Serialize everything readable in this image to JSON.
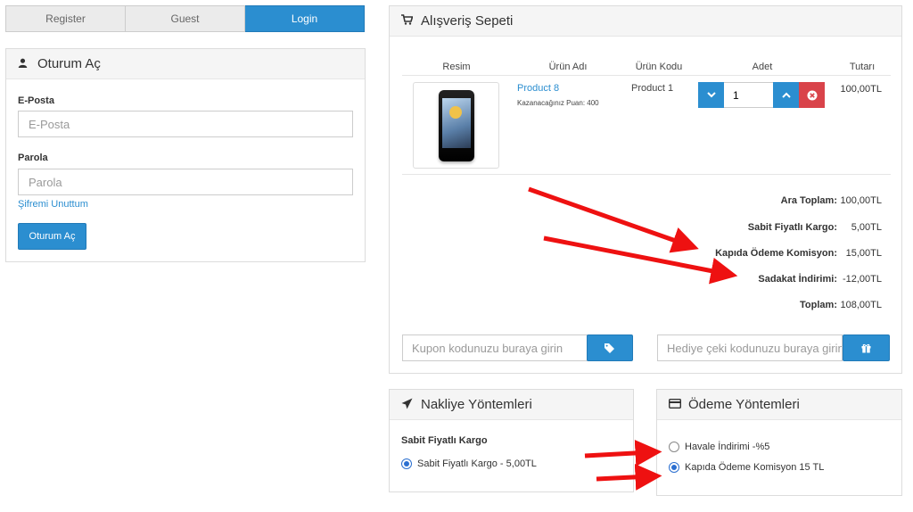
{
  "tabs": [
    {
      "label": "Register",
      "active": false
    },
    {
      "label": "Guest",
      "active": false
    },
    {
      "label": "Login",
      "active": true
    }
  ],
  "login": {
    "title": "Oturum Aç",
    "email_label": "E-Posta",
    "email_placeholder": "E-Posta",
    "password_label": "Parola",
    "password_placeholder": "Parola",
    "forgot_link": "Şifremi Unuttum",
    "submit_label": "Oturum Aç"
  },
  "cart": {
    "title": "Alışveriş Sepeti",
    "columns": [
      "Resim",
      "Ürün Adı",
      "Ürün Kodu",
      "Adet",
      "Tutarı"
    ],
    "item": {
      "name": "Product 8",
      "points": "Kazanacağınız Puan: 400",
      "code": "Product 1",
      "quantity": "1",
      "total": "100,00TL"
    },
    "totals": [
      {
        "label": "Ara Toplam:",
        "value": "100,00TL"
      },
      {
        "label": "Sabit Fiyatlı Kargo:",
        "value": "5,00TL"
      },
      {
        "label": "Kapıda Ödeme Komisyon:",
        "value": "15,00TL"
      },
      {
        "label": "Sadakat İndirimi:",
        "value": "-12,00TL"
      },
      {
        "label": "Toplam:",
        "value": "108,00TL"
      }
    ],
    "coupon_placeholder": "Kupon kodunuzu buraya girin",
    "gift_placeholder": "Hediye çeki kodunuzu buraya girin"
  },
  "shipping": {
    "title": "Nakliye Yöntemleri",
    "group_label": "Sabit Fiyatlı Kargo",
    "option": "Sabit Fiyatlı Kargo - 5,00TL",
    "selected": true
  },
  "payment": {
    "title": "Ödeme Yöntemleri",
    "options": [
      {
        "label": "Havale İndirimi -%5",
        "selected": false
      },
      {
        "label": "Kapıda Ödeme Komisyon 15 TL",
        "selected": true
      }
    ]
  },
  "colors": {
    "primary": "#2b8ed0",
    "danger": "#d9434a",
    "annotation_arrow": "#ee1111"
  }
}
